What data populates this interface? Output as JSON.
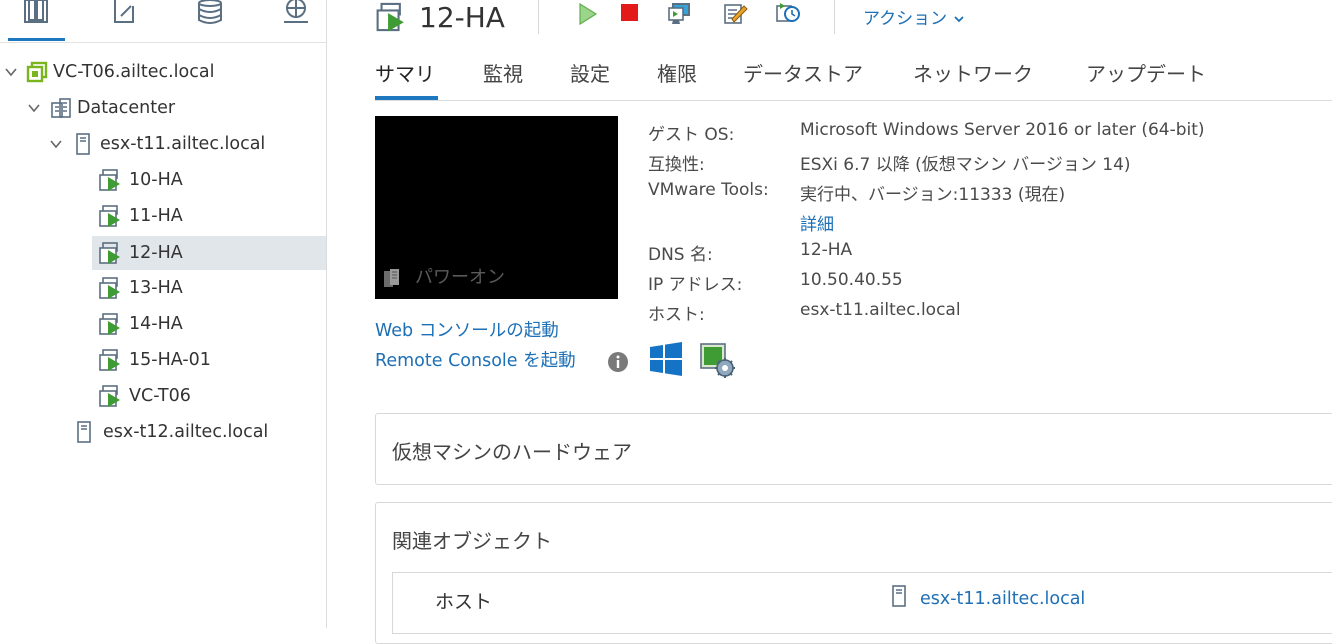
{
  "navigator": {
    "tabs": [
      "hosts-and-clusters",
      "vms-and-templates",
      "storage",
      "networking"
    ],
    "tree": [
      {
        "label": "VC-T06.ailtec.local",
        "icon": "vcenter-icon",
        "expanded": true,
        "level": 0
      },
      {
        "label": "Datacenter",
        "icon": "datacenter-icon",
        "expanded": true,
        "level": 1
      },
      {
        "label": "esx-t11.ailtec.local",
        "icon": "host-icon",
        "expanded": true,
        "level": 2
      },
      {
        "label": "10-HA",
        "icon": "vm-powered-on-icon",
        "level": 3
      },
      {
        "label": "11-HA",
        "icon": "vm-powered-on-icon",
        "level": 3
      },
      {
        "label": "12-HA",
        "icon": "vm-powered-on-icon",
        "level": 3,
        "selected": true
      },
      {
        "label": "13-HA",
        "icon": "vm-powered-on-icon",
        "level": 3
      },
      {
        "label": "14-HA",
        "icon": "vm-powered-on-icon",
        "level": 3
      },
      {
        "label": "15-HA-01",
        "icon": "vm-powered-on-icon",
        "level": 3
      },
      {
        "label": "VC-T06",
        "icon": "vm-powered-on-icon",
        "level": 3
      },
      {
        "label": "esx-t12.ailtec.local",
        "icon": "host-icon",
        "level": 2
      }
    ]
  },
  "header": {
    "title": "12-HA",
    "actions_label": "アクション"
  },
  "tabs": [
    "サマリ",
    "監視",
    "設定",
    "権限",
    "データストア",
    "ネットワーク",
    "アップデート"
  ],
  "active_tab": "サマリ",
  "console": {
    "power_state": "パワーオン",
    "web_console_link": "Web コンソールの起動",
    "remote_console_link": "Remote Console を起動"
  },
  "summary": {
    "guest_os_label": "ゲスト OS:",
    "guest_os": "Microsoft Windows Server 2016 or later (64-bit)",
    "compat_label": "互換性:",
    "compat": "ESXi 6.7 以降 (仮想マシン バージョン 14)",
    "tools_label": "VMware Tools:",
    "tools": "実行中、バージョン:11333 (現在)",
    "details_link": "詳細",
    "dns_label": "DNS 名:",
    "dns": "12-HA",
    "ip_label": "IP アドレス:",
    "ip": "10.50.40.55",
    "host_label": "ホスト:",
    "host": "esx-t11.ailtec.local"
  },
  "hardware_card": {
    "title": "仮想マシンのハードウェア"
  },
  "related_card": {
    "title": "関連オブジェクト",
    "rows": [
      {
        "label": "ホスト",
        "value": "esx-t11.ailtec.local"
      }
    ]
  },
  "colors": {
    "accent": "#1d78bf",
    "link": "#1d6fb6",
    "vm_green": "#3f9c35",
    "selected_bg": "#e1e6eb"
  }
}
